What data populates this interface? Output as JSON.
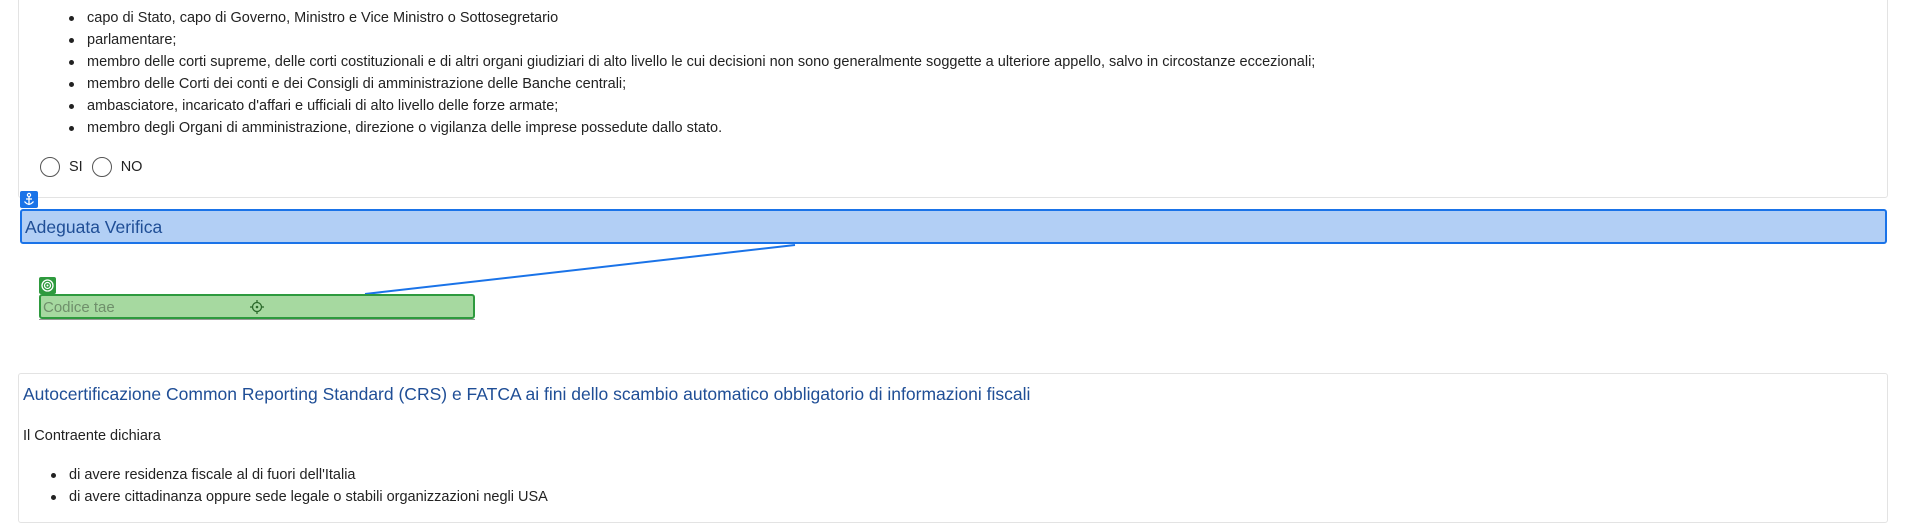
{
  "pep_section": {
    "items": [
      "capo di Stato, capo di Governo, Ministro e Vice Ministro o Sottosegretario",
      "parlamentare;",
      "membro delle corti supreme, delle corti costituzionali e di altri organi giudiziari di alto livello le cui decisioni non sono generalmente soggette a ulteriore appello, salvo in circostanze eccezionali;",
      "membro delle Corti dei conti e dei Consigli di amministrazione delle Banche centrali;",
      "ambasciatore, incaricato d'affari e ufficiali di alto livello delle forze armate;",
      "membro degli Organi di amministrazione, direzione o vigilanza delle imprese possedute dallo stato."
    ],
    "options": {
      "yes": "SI",
      "no": "NO"
    }
  },
  "adeguata_verifica": {
    "title": "Adeguata Verifica",
    "codice_tae_placeholder": "Codice tae"
  },
  "crs_section": {
    "title": "Autocertificazione Common Reporting Standard (CRS) e FATCA ai fini dello scambio automatico obbligatorio di informazioni fiscali",
    "subtitle": "Il Contraente dichiara",
    "items": [
      "di avere residenza fiscale al di fuori dell'Italia",
      "di avere cittadinanza oppure sede legale o stabili organizzazioni negli USA"
    ]
  },
  "colors": {
    "section_highlight": "#b2cff5",
    "section_border": "#1a73e8",
    "field_highlight": "#a6d9a0",
    "field_border": "#2e9a3e",
    "title_text": "#1f4e96"
  },
  "icons": {
    "anchor_badge": "anchor-icon",
    "target_badge": "target-icon",
    "crosshair": "crosshair-icon"
  }
}
